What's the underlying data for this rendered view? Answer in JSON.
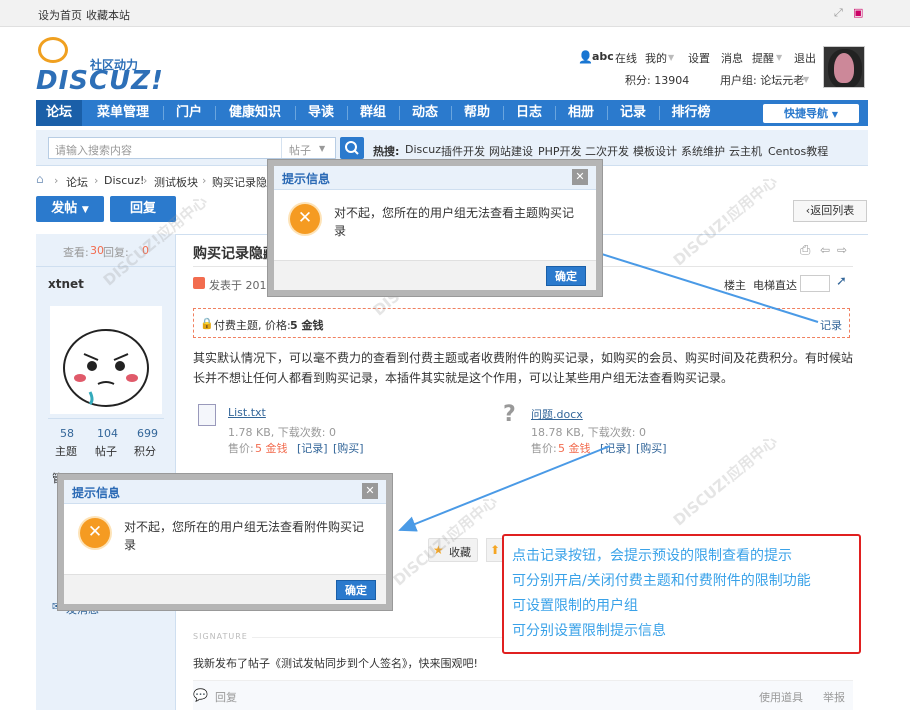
{
  "topbar": {
    "home": "设为首页",
    "bookmark": "收藏本站"
  },
  "logo": {
    "cn": "社区动力",
    "main": "DISCUZ!"
  },
  "user": {
    "name": "abc",
    "status": "在线",
    "my": "我的",
    "settings": "设置",
    "messages": "消息",
    "reminders": "提醒",
    "logout": "退出",
    "points": "积分: 13904",
    "group": "用户组: 论坛元老"
  },
  "nav": {
    "items": [
      "论坛",
      "菜单管理",
      "门户",
      "健康知识",
      "导读",
      "群组",
      "动态",
      "帮助",
      "日志",
      "相册",
      "记录",
      "排行榜"
    ],
    "quick": "快捷导航"
  },
  "search": {
    "placeholder": "请输入搜索内容",
    "type": "帖子",
    "hot_label": "热搜:",
    "hot": [
      "Discuz",
      "插件开发",
      "网站建设",
      "PHP开发",
      "二次开发",
      "模板设计",
      "系统维护",
      "云主机",
      "Centos教程"
    ]
  },
  "breadcrumb": [
    "论坛",
    "Discuz!",
    "测试板块",
    "购买记录隐藏"
  ],
  "buttons": {
    "post": "发帖",
    "reply": "回复",
    "back": "返回列表"
  },
  "thread": {
    "views_label": "查看:",
    "views": "30",
    "replies_label": "回复:",
    "replies": "0",
    "title": "购买记录隐藏",
    "author": "xtnet",
    "posted": "发表于 2017-1",
    "floor_owner": "楼主",
    "floor_jump": "电梯直达",
    "stats": [
      {
        "value": "58",
        "label": "主题"
      },
      {
        "value": "104",
        "label": "帖子"
      },
      {
        "value": "699",
        "label": "积分"
      }
    ],
    "admin": "管理员",
    "send_msg": "发消息"
  },
  "paid": {
    "text": "付费主题, 价格:",
    "price": "5 金钱",
    "record": "记录"
  },
  "content": "其实默认情况下，可以毫不费力的查看到付费主题或者收费附件的购买记录，如购买的会员、购买时间及花费积分。有时候站长并不想让任何人都看到购买记录，本插件其实就是这个作用，可以让某些用户组无法查看购买记录。",
  "attachments": [
    {
      "name": "List.txt",
      "meta": "1.78 KB, 下载次数: 0",
      "price_label": "售价:",
      "price": "5 金钱",
      "record": "[记录]",
      "buy": "[购买]"
    },
    {
      "name": "问题.docx",
      "meta": "18.78 KB, 下载次数: 0",
      "price_label": "售价:",
      "price": "5 金钱",
      "record": "[记录]",
      "buy": "[购买]"
    }
  ],
  "actions": {
    "favorite": "收藏"
  },
  "signature": {
    "label": "SIGNATURE",
    "text": "我新发布了帖子《测试发帖同步到个人签名》，快来围观吧!"
  },
  "footer": {
    "reply": "回复",
    "tools": "使用道具",
    "report": "举报"
  },
  "dialog1": {
    "title": "提示信息",
    "message": "对不起，您所在的用户组无法查看主题购买记录",
    "ok": "确定"
  },
  "dialog2": {
    "title": "提示信息",
    "message": "对不起，您所在的用户组无法查看附件购买记录",
    "ok": "确定"
  },
  "note": [
    "点击记录按钮，会提示预设的限制查看的提示",
    "可分别开启/关闭付费主题和付费附件的限制功能",
    "可设置限制的用户组",
    "可分别设置限制提示信息"
  ],
  "colors": {
    "primary": "#2b7acd",
    "note_border": "#e02020",
    "note_text": "#3aa2e8",
    "warning": "#f59b22"
  }
}
